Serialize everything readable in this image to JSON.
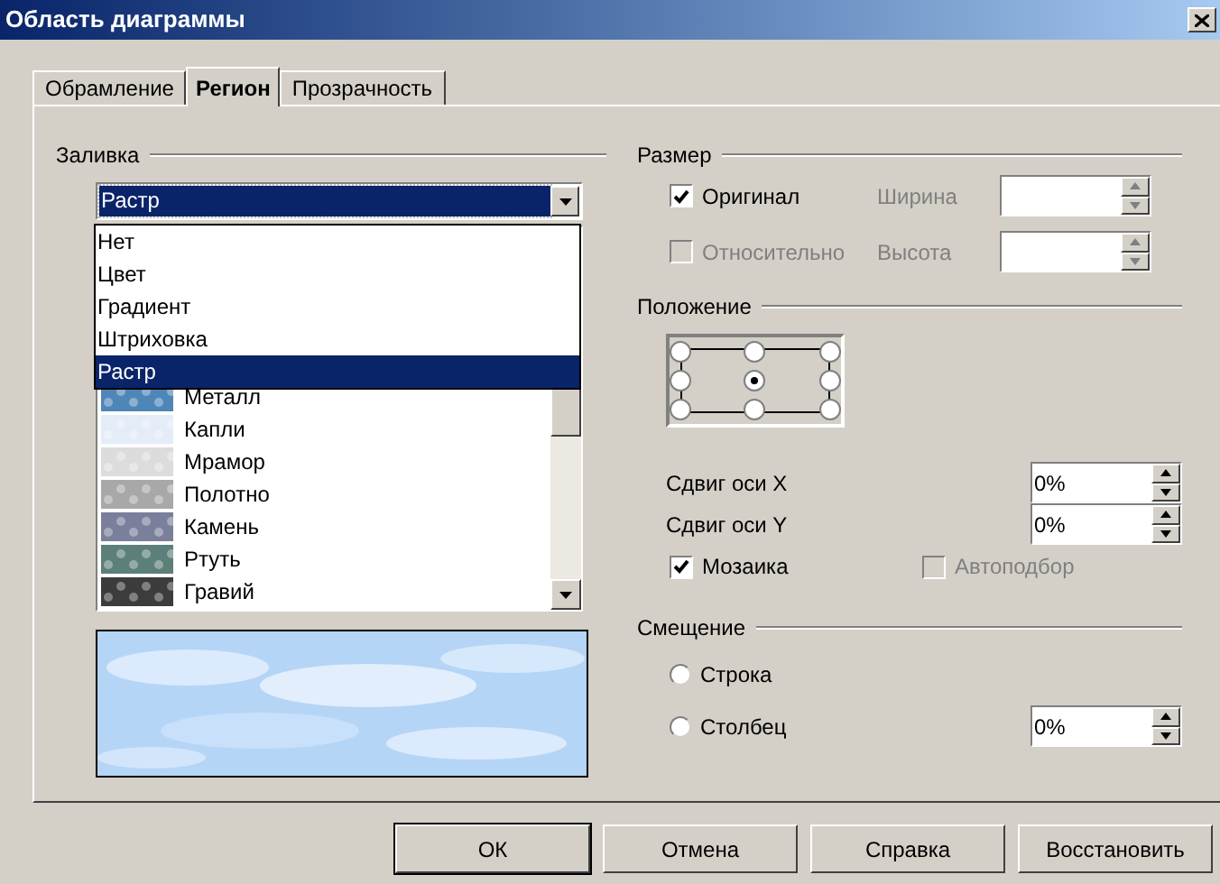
{
  "window": {
    "title": "Область диаграммы"
  },
  "tabs": [
    {
      "label": "Обрамление",
      "selected": false
    },
    {
      "label": "Регион",
      "selected": true
    },
    {
      "label": "Прозрачность",
      "selected": false
    }
  ],
  "fill": {
    "title": "Заливка",
    "combo": {
      "value": "Растр",
      "expanded": true
    },
    "options": [
      {
        "label": "Нет",
        "selected": false
      },
      {
        "label": "Цвет",
        "selected": false
      },
      {
        "label": "Градиент",
        "selected": false
      },
      {
        "label": "Штриховка",
        "selected": false
      },
      {
        "label": "Растр",
        "selected": true
      }
    ],
    "bitmaps": [
      {
        "label": "Металл",
        "color": "#4f86b8"
      },
      {
        "label": "Капли",
        "color": "#e4ecf8"
      },
      {
        "label": "Мрамор",
        "color": "#dcdcdc"
      },
      {
        "label": "Полотно",
        "color": "#a8a8a8"
      },
      {
        "label": "Камень",
        "color": "#7a7f9c"
      },
      {
        "label": "Ртуть",
        "color": "#5d7f79"
      },
      {
        "label": "Гравий",
        "color": "#3c3c3c"
      }
    ]
  },
  "size": {
    "title": "Размер",
    "original": {
      "label": "Оригинал",
      "checked": true,
      "disabled": false
    },
    "relative": {
      "label": "Относительно",
      "checked": false,
      "disabled": true
    },
    "width": {
      "label": "Ширина",
      "disabled": true
    },
    "height": {
      "label": "Высота",
      "disabled": true
    }
  },
  "position": {
    "title": "Положение",
    "points": [
      {
        "selected": false
      },
      {
        "selected": false
      },
      {
        "selected": false
      },
      {
        "selected": false
      },
      {
        "selected": true
      },
      {
        "selected": false
      },
      {
        "selected": false
      },
      {
        "selected": false
      },
      {
        "selected": false
      }
    ],
    "offset_x": {
      "label": "Сдвиг оси X",
      "value": "0%"
    },
    "offset_y": {
      "label": "Сдвиг оси Y",
      "value": "0%"
    },
    "tile": {
      "label": "Мозаика",
      "checked": true,
      "disabled": false
    },
    "autofit": {
      "label": "Автоподбор",
      "checked": false,
      "disabled": true
    }
  },
  "shift": {
    "title": "Смещение",
    "options": [
      {
        "label": "Строка",
        "selected": false
      },
      {
        "label": "Столбец",
        "selected": false
      }
    ],
    "value": "0%"
  },
  "buttons": [
    {
      "label": "ОК",
      "default": true
    },
    {
      "label": "Отмена",
      "default": false
    },
    {
      "label": "Справка",
      "default": false
    },
    {
      "label": "Восстановить",
      "default": false
    }
  ]
}
